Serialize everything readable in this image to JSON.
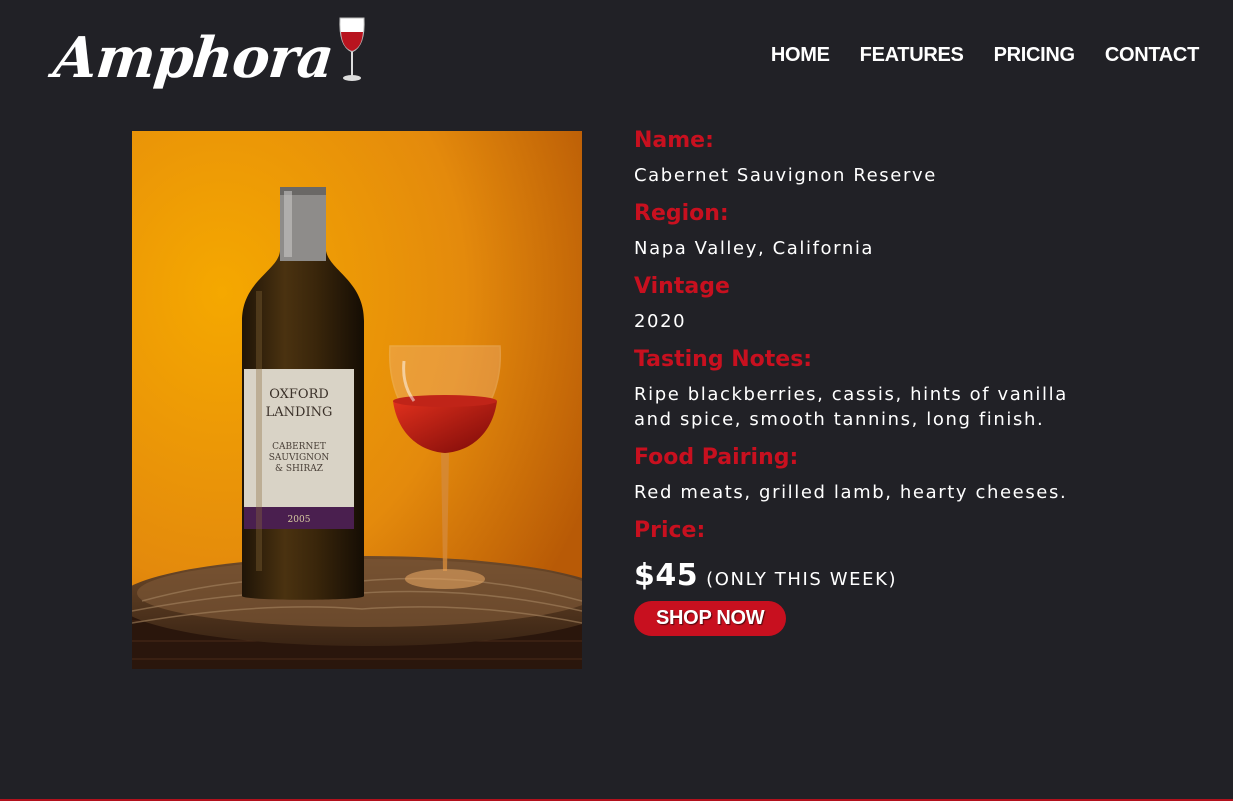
{
  "header": {
    "logo_text": "Amphora",
    "nav": [
      {
        "label": "HOME"
      },
      {
        "label": "FEATURES"
      },
      {
        "label": "PRICING"
      },
      {
        "label": "CONTACT"
      }
    ]
  },
  "product": {
    "image_bottle_label": {
      "line1": "OXFORD",
      "line2": "LANDING",
      "line3": "CABERNET",
      "line4": "SAUVIGNON",
      "line5": "& SHIRAZ",
      "line6": "2005"
    },
    "fields": {
      "name_label": "Name:",
      "name_value": "Cabernet Sauvignon Reserve",
      "region_label": "Region:",
      "region_value": "Napa Valley, California",
      "vintage_label": "Vintage",
      "vintage_value": "2020",
      "notes_label": "Tasting Notes:",
      "notes_value": "Ripe blackberries, cassis, hints of vanilla and spice, smooth tannins, long finish.",
      "pairing_label": "Food Pairing:",
      "pairing_value": "Red meats, grilled lamb, hearty cheeses.",
      "price_label": "Price:",
      "price_amount": "$45",
      "price_note": "(ONLY THIS WEEK)"
    },
    "shop_button": "SHOP NOW"
  },
  "colors": {
    "background": "#212126",
    "accent": "#c8101f",
    "text": "#ffffff"
  }
}
